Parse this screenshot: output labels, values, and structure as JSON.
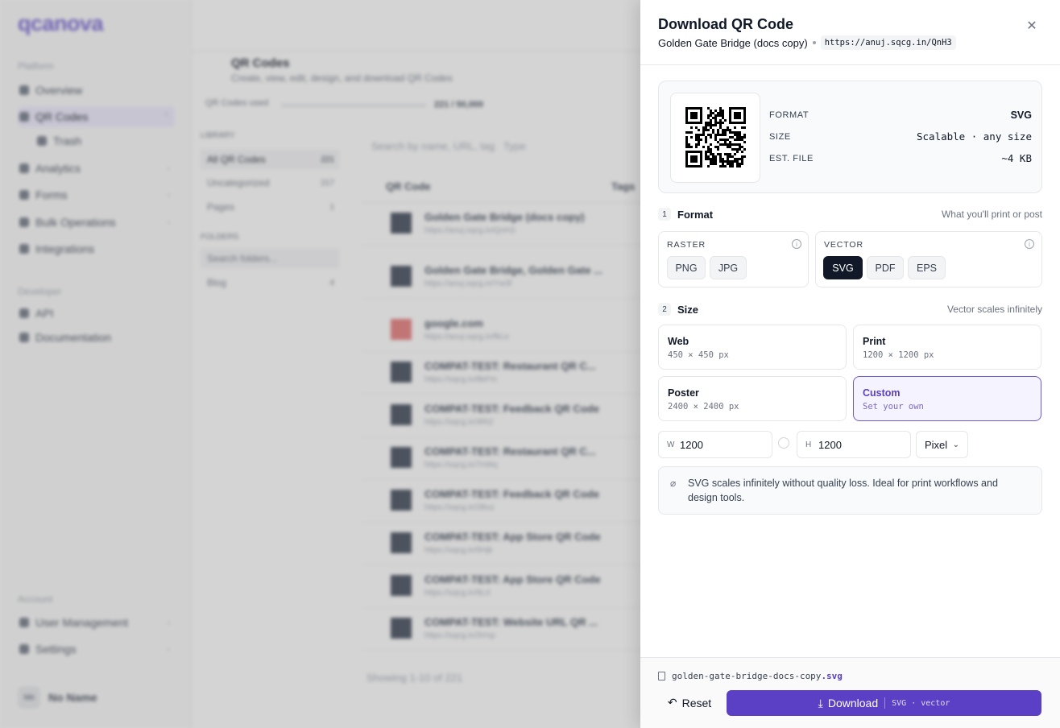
{
  "background": {
    "logo": "qcanova",
    "sidebar": {
      "section_platform": "Platform",
      "items": [
        {
          "label": "Overview"
        },
        {
          "label": "QR Codes"
        },
        {
          "label": "Trash"
        },
        {
          "label": "Analytics"
        },
        {
          "label": "Forms"
        },
        {
          "label": "Bulk Operations"
        },
        {
          "label": "Integrations"
        }
      ],
      "section_developer": "Developer",
      "dev_items": [
        {
          "label": "API"
        },
        {
          "label": "Documentation"
        }
      ],
      "section_account": "Account",
      "account_items": [
        {
          "label": "User Management"
        },
        {
          "label": "Settings"
        }
      ],
      "user_initials": "NN",
      "user_name": "No Name"
    },
    "page_title": "QR Codes",
    "page_subtitle": "Create, view, edit, design, and download QR Codes",
    "limit_label": "QR Codes used",
    "limit_value": "221 / 50,000",
    "library": {
      "heading": "LIBRARY",
      "items": [
        {
          "label": "All QR Codes",
          "count": "221"
        },
        {
          "label": "Uncategorized",
          "count": "217"
        },
        {
          "label": "Pages",
          "count": "1"
        }
      ],
      "folders_heading": "FOLDERS",
      "folders_search": "Search folders...",
      "folders": [
        {
          "label": "Blog",
          "count": "4"
        }
      ]
    },
    "table": {
      "search_placeholder": "Search by name, URL, tag",
      "filter_type": "Type",
      "col_qr": "QR Code",
      "col_tags": "Tags",
      "rows": [
        {
          "name": "Golden Gate Bridge (docs copy)",
          "url": "https://anuj.sqcg.in/QnH3"
        },
        {
          "name": "Golden Gate Bridge, Golden Gate ...",
          "url": "https://anuj.sqcg.in/Yw3f"
        },
        {
          "name": "google.com",
          "url": "https://anuj.sqcg.in/fkLe"
        },
        {
          "name": "COMPAT-TEST: Restaurant QR C...",
          "url": "https://sqcg.in/8kPm"
        },
        {
          "name": "COMPAT-TEST: Feedback QR Code",
          "url": "https://sqcg.in/4Rt2"
        },
        {
          "name": "COMPAT-TEST: Restaurant QR C...",
          "url": "https://sqcg.in/7nWq"
        },
        {
          "name": "COMPAT-TEST: Feedback QR Code",
          "url": "https://sqcg.in/2Bxz"
        },
        {
          "name": "COMPAT-TEST: App Store QR Code",
          "url": "https://sqcg.in/5Hjk"
        },
        {
          "name": "COMPAT-TEST: App Store QR Code",
          "url": "https://sqcg.in/9Lrt"
        },
        {
          "name": "COMPAT-TEST: Website URL QR ...",
          "url": "https://sqcg.in/3Vnp"
        }
      ],
      "showing": "Showing 1-10 of 221"
    }
  },
  "drawer": {
    "title": "Download QR Code",
    "qr_name": "Golden Gate Bridge (docs copy)",
    "short_url": "https://anuj.sqcg.in/QnH3",
    "close_icon": "close-icon",
    "preview": {
      "format_key": "FORMAT",
      "format_val": "SVG",
      "size_key": "SIZE",
      "size_val": "Scalable · any size",
      "file_key": "EST. FILE",
      "file_val": "~4 KB"
    },
    "format_section": {
      "num": "1",
      "title": "Format",
      "hint": "What you'll print or post"
    },
    "raster": {
      "label": "RASTER",
      "options": [
        "PNG",
        "JPG"
      ]
    },
    "vector": {
      "label": "VECTOR",
      "options": [
        "SVG",
        "PDF",
        "EPS"
      ],
      "selected": "SVG"
    },
    "size_section": {
      "num": "2",
      "title": "Size",
      "hint": "Vector scales infinitely"
    },
    "sizes": [
      {
        "name": "Web",
        "dims": "450 × 450 px"
      },
      {
        "name": "Print",
        "dims": "1200 × 1200 px"
      },
      {
        "name": "Poster",
        "dims": "2400 × 2400 px"
      },
      {
        "name": "Custom",
        "dims": "Set your own"
      }
    ],
    "selected_size": "Custom",
    "width_prefix": "W",
    "width_value": "1200",
    "height_prefix": "H",
    "height_value": "1200",
    "unit": "Pixel",
    "note": "SVG scales infinitely without quality loss. Ideal for print workflows and design tools.",
    "filename_base": "golden-gate-bridge-docs-copy",
    "filename_ext": ".svg",
    "reset_label": "Reset",
    "download_label": "Download",
    "download_meta": "SVG · vector",
    "colors": {
      "accent": "#5b3fc4",
      "selected_chip": "#111827",
      "custom_border": "#6d5bd0"
    }
  }
}
